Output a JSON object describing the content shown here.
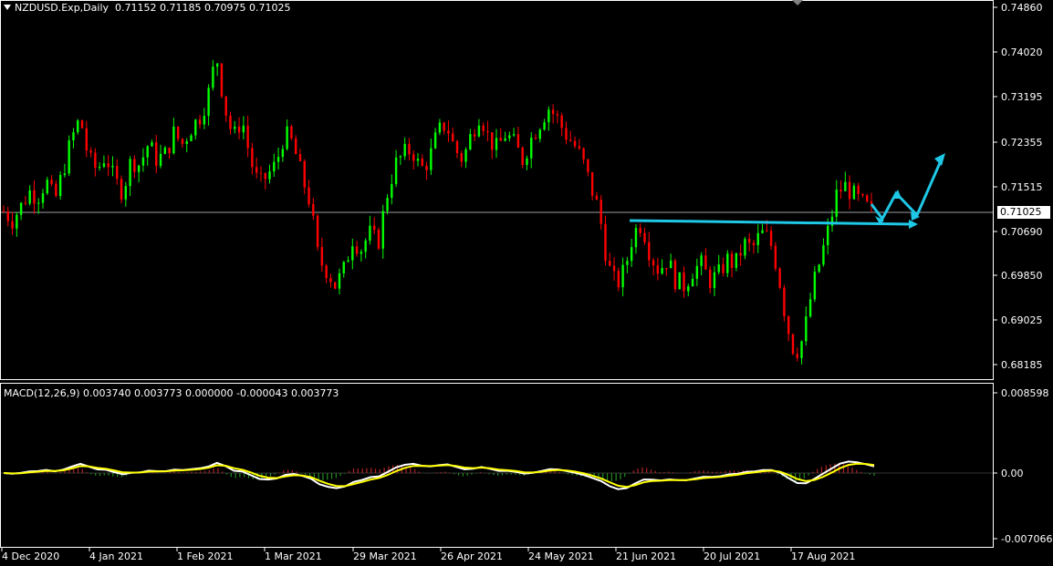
{
  "header": {
    "symbol": "NZDUSD.Exp,Daily",
    "open": "0.71152",
    "high": "0.71185",
    "low": "0.70975",
    "close": "0.71025"
  },
  "current_price": "0.71025",
  "price_axis": {
    "ticks": [
      "0.74860",
      "0.74020",
      "0.73195",
      "0.72355",
      "0.71515",
      "0.70690",
      "0.69850",
      "0.69025",
      "0.68185"
    ]
  },
  "macd": {
    "label": "MACD(12,26,9)",
    "values": "0.003740 0.003773 0.000000 -0.000043 0.003773",
    "axis_ticks": [
      "0.008598",
      "0.00",
      "-0.007066"
    ]
  },
  "time_axis": {
    "labels": [
      "4 Dec 2020",
      "4 Jan 2021",
      "1 Feb 2021",
      "1 Mar 2021",
      "29 Mar 2021",
      "26 Apr 2021",
      "24 May 2021",
      "21 Jun 2021",
      "20 Jul 2021",
      "17 Aug 2021"
    ]
  },
  "colors": {
    "bull": "#00ff00",
    "bear": "#ff0000",
    "trendline": "#1ec8e6",
    "macd_main": "#ffffff",
    "macd_signal": "#ffff00",
    "hist_pos": "#b22222",
    "hist_neg": "#228b22"
  },
  "chart_data": {
    "type": "candlestick",
    "close_path": [
      0.7102,
      0.7085,
      0.711,
      0.714,
      0.713,
      0.716,
      0.712,
      0.718,
      0.724,
      0.728,
      0.72,
      0.718,
      0.721,
      0.716,
      0.714,
      0.72,
      0.719,
      0.723,
      0.72,
      0.721,
      0.725,
      0.723,
      0.726,
      0.728,
      0.732,
      0.74,
      0.73,
      0.724,
      0.728,
      0.72,
      0.715,
      0.717,
      0.719,
      0.725,
      0.723,
      0.717,
      0.712,
      0.701,
      0.699,
      0.696,
      0.699,
      0.705,
      0.703,
      0.706,
      0.704,
      0.713,
      0.719,
      0.721,
      0.722,
      0.718,
      0.72,
      0.725,
      0.727,
      0.722,
      0.72,
      0.725,
      0.729,
      0.724,
      0.722,
      0.725,
      0.723,
      0.72,
      0.724,
      0.727,
      0.73,
      0.728,
      0.725,
      0.723,
      0.72,
      0.715,
      0.71,
      0.7,
      0.696,
      0.699,
      0.706,
      0.708,
      0.702,
      0.699,
      0.701,
      0.697,
      0.696,
      0.699,
      0.7,
      0.697,
      0.698,
      0.701,
      0.7,
      0.704,
      0.703,
      0.706,
      0.705,
      0.699,
      0.689,
      0.683,
      0.686,
      0.695,
      0.701,
      0.707,
      0.714,
      0.715,
      0.713,
      0.7115,
      0.7102
    ],
    "trendlines": [
      {
        "from": [
          "21 Jun 2021",
          0.7108
        ],
        "to": [
          "beyond",
          0.7095
        ]
      },
      {
        "projection": "zigzag-up",
        "points": [
          0.7125,
          0.7105,
          0.7145,
          0.711,
          0.72
        ]
      }
    ],
    "ylim": [
      0.681,
      0.749
    ]
  }
}
